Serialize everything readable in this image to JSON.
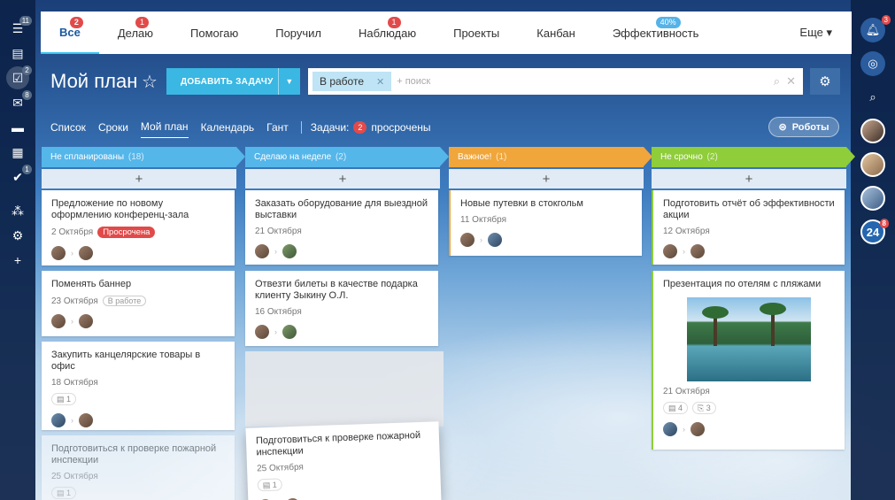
{
  "left_sidebar": {
    "items": [
      {
        "icon": "filter-icon",
        "glyph": "☰",
        "badge": "11"
      },
      {
        "icon": "list-icon",
        "glyph": "▤",
        "badge": ""
      },
      {
        "icon": "tasks-icon",
        "glyph": "☑",
        "badge": "2",
        "active": true
      },
      {
        "icon": "chat-icon",
        "glyph": "✉",
        "badge": "8"
      },
      {
        "icon": "drive-icon",
        "glyph": "▬",
        "badge": ""
      },
      {
        "icon": "calendar-icon",
        "glyph": "▦",
        "badge": ""
      },
      {
        "icon": "check-icon",
        "glyph": "✔",
        "badge": "1"
      },
      {
        "icon": "sitemap-icon",
        "glyph": "⁂",
        "badge": ""
      },
      {
        "icon": "gear-icon",
        "glyph": "⚙",
        "badge": ""
      },
      {
        "icon": "plus-icon",
        "glyph": "+",
        "badge": ""
      }
    ]
  },
  "right_sidebar": {
    "notifications_badge": "3",
    "bitrix24_label": "24",
    "bitrix24_badge": "8"
  },
  "topnav": {
    "items": [
      {
        "label": "Все",
        "badge": "2"
      },
      {
        "label": "Делаю",
        "badge": "1"
      },
      {
        "label": "Помогаю",
        "badge": ""
      },
      {
        "label": "Поручил",
        "badge": ""
      },
      {
        "label": "Наблюдаю",
        "badge": "1"
      },
      {
        "label": "Проекты",
        "badge": ""
      },
      {
        "label": "Канбан",
        "badge": ""
      },
      {
        "label": "Эффективность",
        "badge": "40%"
      }
    ],
    "more_label": "Еще ▾"
  },
  "header": {
    "title": "Мой план",
    "add_task_label": "ДОБАВИТЬ ЗАДАЧУ",
    "filter_chip": "В работе",
    "search_placeholder": "+ поиск"
  },
  "view_tabs": {
    "tabs": [
      "Список",
      "Сроки",
      "Мой план",
      "Календарь",
      "Гант"
    ],
    "active": "Мой план",
    "tasks_label": "Задачи:",
    "overdue_count": "2",
    "overdue_label": "просрочены",
    "robots_label": "Роботы"
  },
  "colors": {
    "col1": "#55b6ea",
    "col2": "#55b6ea",
    "col3": "#f0a63a",
    "col4": "#8fcd3a",
    "overdue": "#e24a4a"
  },
  "columns": [
    {
      "title": "Не спланированы",
      "count": "(18)",
      "cards": [
        {
          "title": "Предложение по новому оформлению конференц-зала",
          "date": "2 Октября",
          "badge": "Просрочена",
          "badge_type": "overdue"
        },
        {
          "title": "Поменять баннер",
          "date": "23 Октября",
          "badge": "В работе",
          "badge_type": "status"
        },
        {
          "title": "Закупить канцелярские товары в офис",
          "date": "18 Октября",
          "comments": "1"
        },
        {
          "title": "Подготовиться к проверке пожарной инспекции",
          "date": "25 Октября",
          "comments": "1"
        }
      ]
    },
    {
      "title": "Сделаю на неделе",
      "count": "(2)",
      "cards": [
        {
          "title": "Заказать оборудование для выездной выставки",
          "date": "21 Октября"
        },
        {
          "title": "Отвезти билеты в качестве подарка клиенту Зыкину О.Л.",
          "date": "16 Октября"
        },
        {
          "title": "Подготовиться к проверке пожарной инспекции",
          "date": "25 Октября",
          "comments": "1"
        }
      ]
    },
    {
      "title": "Важное!",
      "count": "(1)",
      "cards": [
        {
          "title": "Новые путевки в стокгольм",
          "date": "11 Октября"
        }
      ]
    },
    {
      "title": "Не срочно",
      "count": "(2)",
      "cards": [
        {
          "title": "Подготовить отчёт об эффективности акции",
          "date": "12 Октября"
        },
        {
          "title": "Презентация по отелям с пляжами",
          "date": "21 Октября",
          "comments": "4",
          "attachments": "3"
        }
      ]
    }
  ]
}
